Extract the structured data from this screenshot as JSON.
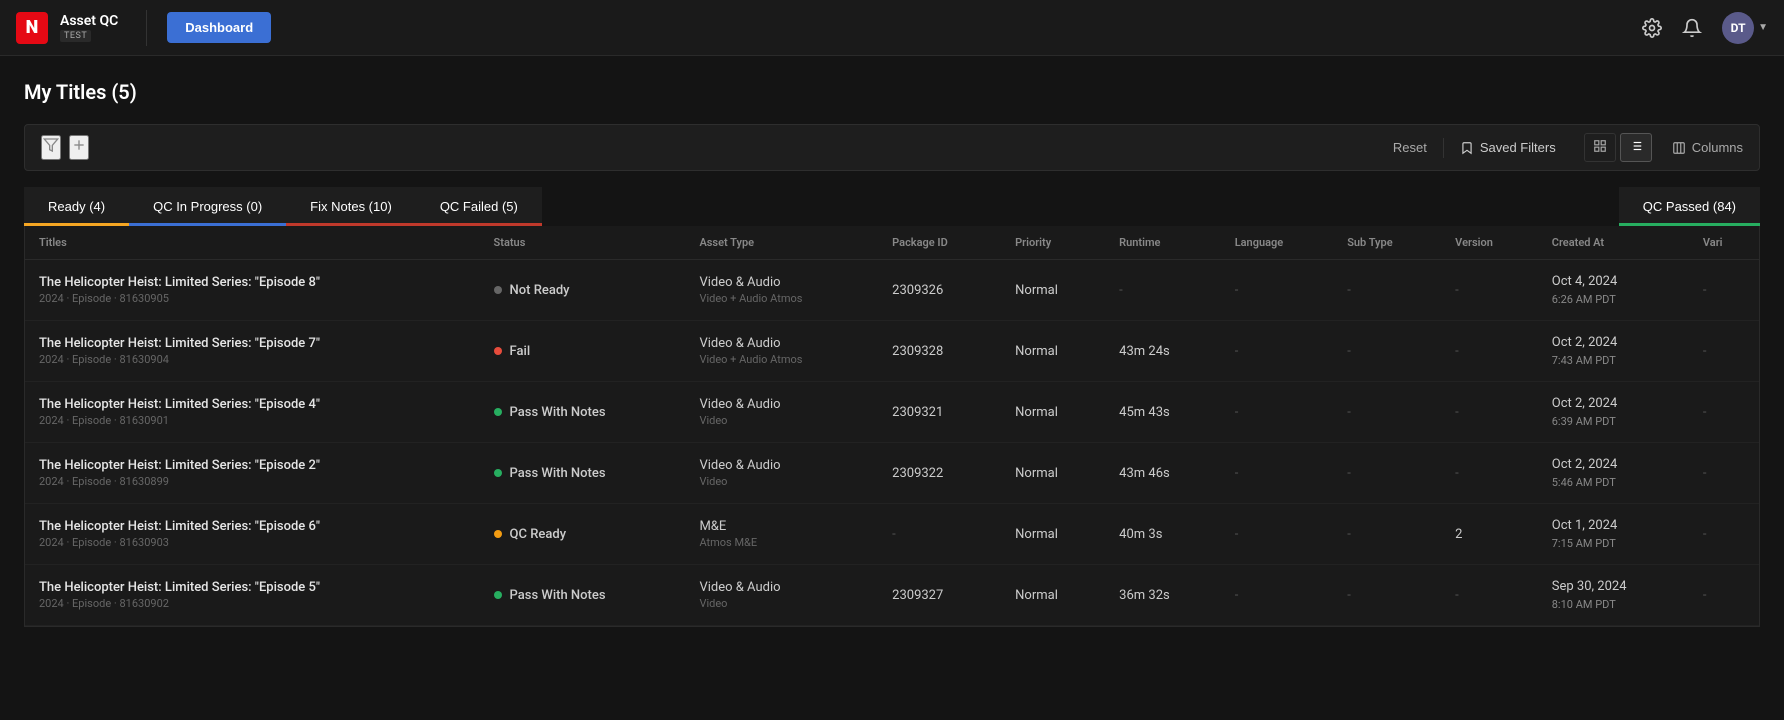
{
  "app": {
    "logo": "N",
    "title": "Asset QC",
    "badge": "TEST",
    "nav_button": "Dashboard",
    "settings_icon": "⚙",
    "bell_icon": "🔔",
    "avatar_initials": "DT"
  },
  "page": {
    "title": "My Titles (5)"
  },
  "filter_bar": {
    "reset_label": "Reset",
    "saved_filters_label": "Saved Filters",
    "columns_label": "Columns"
  },
  "tabs": [
    {
      "label": "Ready (4)",
      "type": "ready"
    },
    {
      "label": "QC In Progress (0)",
      "type": "inprogress"
    },
    {
      "label": "Fix Notes (10)",
      "type": "fixnotes"
    },
    {
      "label": "QC Failed (5)",
      "type": "qcfailed"
    },
    {
      "label": "QC Passed (84)",
      "type": "qcpassed"
    }
  ],
  "table": {
    "columns": [
      "Titles",
      "Status",
      "Asset Type",
      "Package ID",
      "Priority",
      "Runtime",
      "Language",
      "Sub Type",
      "Version",
      "Created At",
      "Vari"
    ],
    "rows": [
      {
        "title": "The Helicopter Heist: Limited Series: \"Episode 8\"",
        "subtitle": "2024 · Episode · 81630905",
        "status": "Not Ready",
        "status_dot": "gray",
        "asset_type": "Video & Audio",
        "asset_type_sub": "Video + Audio Atmos",
        "package_id": "2309326",
        "priority": "Normal",
        "runtime": "-",
        "language": "-",
        "sub_type": "-",
        "version": "-",
        "created_at": "Oct 4, 2024\n6:26 AM PDT",
        "variant": "-"
      },
      {
        "title": "The Helicopter Heist: Limited Series: \"Episode 7\"",
        "subtitle": "2024 · Episode · 81630904",
        "status": "Fail",
        "status_dot": "red",
        "asset_type": "Video & Audio",
        "asset_type_sub": "Video + Audio Atmos",
        "package_id": "2309328",
        "priority": "Normal",
        "runtime": "43m 24s",
        "language": "-",
        "sub_type": "-",
        "version": "-",
        "created_at": "Oct 2, 2024\n7:43 AM PDT",
        "variant": "-"
      },
      {
        "title": "The Helicopter Heist: Limited Series: \"Episode 4\"",
        "subtitle": "2024 · Episode · 81630901",
        "status": "Pass With Notes",
        "status_dot": "green",
        "asset_type": "Video & Audio",
        "asset_type_sub": "Video",
        "package_id": "2309321",
        "priority": "Normal",
        "runtime": "45m 43s",
        "language": "-",
        "sub_type": "-",
        "version": "-",
        "created_at": "Oct 2, 2024\n6:39 AM PDT",
        "variant": "-"
      },
      {
        "title": "The Helicopter Heist: Limited Series: \"Episode 2\"",
        "subtitle": "2024 · Episode · 81630899",
        "status": "Pass With Notes",
        "status_dot": "green",
        "asset_type": "Video & Audio",
        "asset_type_sub": "Video",
        "package_id": "2309322",
        "priority": "Normal",
        "runtime": "43m 46s",
        "language": "-",
        "sub_type": "-",
        "version": "-",
        "created_at": "Oct 2, 2024\n5:46 AM PDT",
        "variant": "-"
      },
      {
        "title": "The Helicopter Heist: Limited Series: \"Episode 6\"",
        "subtitle": "2024 · Episode · 81630903",
        "status": "QC Ready",
        "status_dot": "yellow",
        "asset_type": "M&E",
        "asset_type_sub": "Atmos M&E",
        "package_id": "-",
        "priority": "Normal",
        "runtime": "40m 3s",
        "language": "-",
        "sub_type": "-",
        "version": "2",
        "created_at": "Oct 1, 2024\n7:15 AM PDT",
        "variant": "-"
      },
      {
        "title": "The Helicopter Heist: Limited Series: \"Episode 5\"",
        "subtitle": "2024 · Episode · 81630902",
        "status": "Pass With Notes",
        "status_dot": "green",
        "asset_type": "Video & Audio",
        "asset_type_sub": "Video",
        "package_id": "2309327",
        "priority": "Normal",
        "runtime": "36m 32s",
        "language": "-",
        "sub_type": "-",
        "version": "-",
        "created_at": "Sep 30, 2024\n8:10 AM PDT",
        "variant": "-"
      }
    ]
  }
}
